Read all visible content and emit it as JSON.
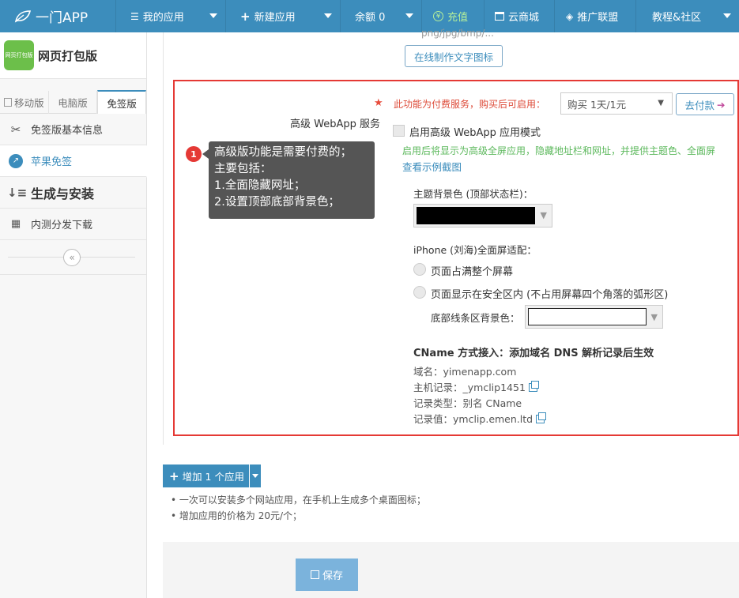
{
  "nav": {
    "brand": "一门APP",
    "items": [
      {
        "label": "我的应用",
        "icon": "list-icon"
      },
      {
        "label": "新建应用",
        "icon": "plus-icon"
      },
      {
        "label": "余额 0"
      },
      {
        "label": "充值",
        "icon": "yen-icon"
      },
      {
        "label": "云商城",
        "icon": "shop-icon"
      },
      {
        "label": "推广联盟",
        "icon": "diamond-icon"
      },
      {
        "label": "教程&社区"
      }
    ]
  },
  "sidebar": {
    "app_logo_text": "网页打包版",
    "app_name": "网页打包版",
    "tabs": [
      "移动版",
      "电脑版",
      "免签版"
    ],
    "items": [
      {
        "label": "免签版基本信息",
        "icon": "scissors-icon"
      },
      {
        "label": "苹果免签",
        "icon": "compass-icon"
      },
      {
        "label": "生成与安装",
        "icon": "sort-down-icon"
      },
      {
        "label": "内测分发下载",
        "icon": "qrcode-icon"
      }
    ],
    "collapse_glyph": "«"
  },
  "main": {
    "top_hint": "png/jpg/bmp/...",
    "make_icon_button": "在线制作文字图标",
    "paid_note": "此功能为付费服务，购买后可启用：",
    "buy_select": "购买 1天/1元",
    "pay_button": "去付款",
    "service_label": "高级 WebApp 服务",
    "enable_label": "启用高级 WebApp 应用模式",
    "enable_hint": "启用后将显示为高级全屏应用，隐藏地址栏和网址，并提供主题色、全面屏",
    "sample_link": "查看示例截图",
    "tooltip_badge": "1",
    "tooltip_lines": [
      "高级版功能是需要付费的；",
      "主要包括：",
      "1.全面隐藏网址；",
      "2.设置顶部底部背景色；"
    ],
    "theme_label": "主题背景色 (顶部状态栏)：",
    "iphone_label": "iPhone (刘海)全面屏适配：",
    "radio_full": "页面占满整个屏幕",
    "radio_safe": "页面显示在安全区内 (不占用屏幕四个角落的弧形区)",
    "bottom_color_label": "底部线条区背景色：",
    "cname_title": "CName 方式接入：添加域名 DNS 解析记录后生效",
    "cname": [
      {
        "key": "域名：",
        "value": "yimenapp.com",
        "copy": false
      },
      {
        "key": "主机记录：",
        "value": "_ymclip1451",
        "copy": true
      },
      {
        "key": "记录类型：",
        "value": "别名 CName",
        "copy": false
      },
      {
        "key": "记录值：",
        "value": "ymclip.emen.ltd",
        "copy": true
      }
    ],
    "add_app_button": "增加 1 个应用",
    "add_notes": [
      "一次可以安装多个网站应用，在手机上生成多个桌面图标；",
      "增加应用的价格为 20元/个；"
    ],
    "save_button": "保存"
  },
  "colors": {
    "nav": "#3c8dbc",
    "red": "#e53935",
    "green_hint": "#5cb85c",
    "link": "#3c8dbc",
    "theme_color_value": "#000000",
    "bottom_color_value": "#ffffff"
  }
}
